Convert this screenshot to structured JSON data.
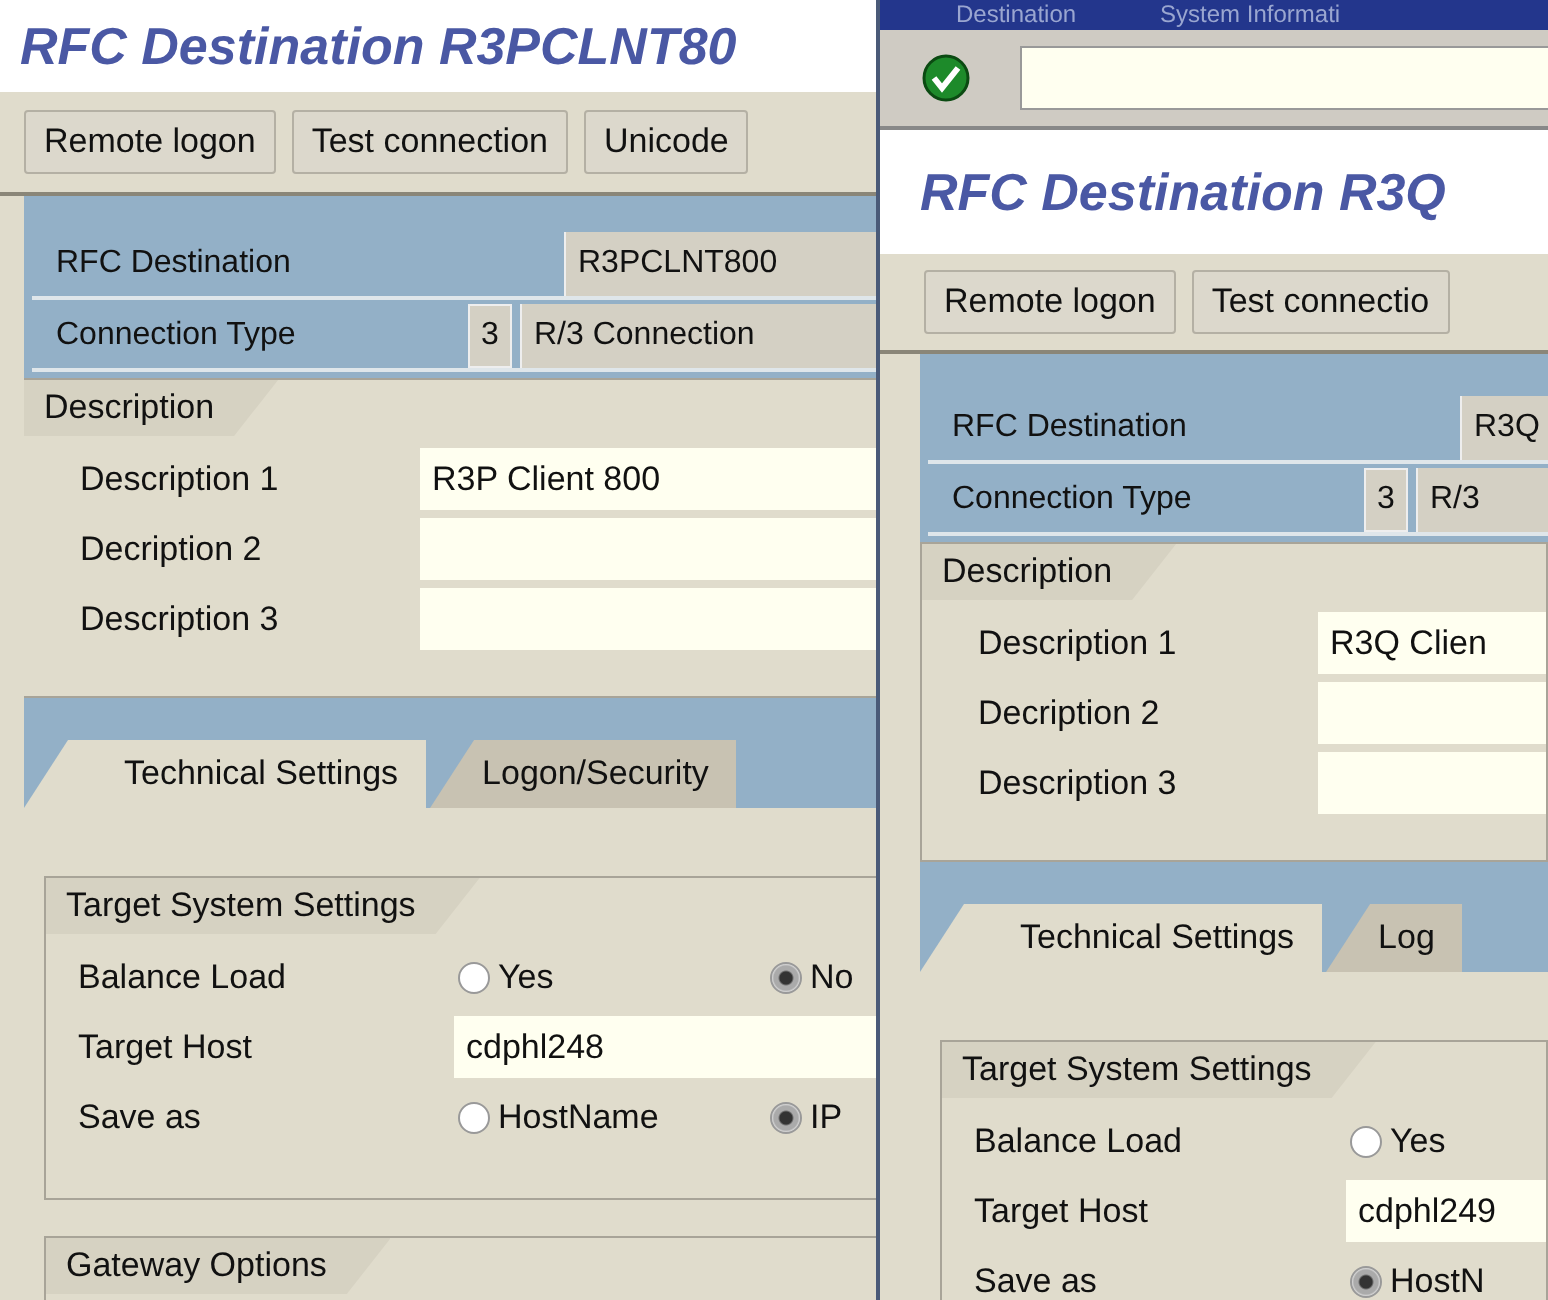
{
  "back_window": {
    "title": "RFC Destination R3PCLNT80",
    "buttons": [
      "Remote logon",
      "Test connection",
      "Unicode"
    ],
    "rfc_destination": {
      "label": "RFC Destination",
      "value": "R3PCLNT800"
    },
    "connection_type": {
      "label": "Connection Type",
      "code": "3",
      "value": "R/3 Connection"
    },
    "description": {
      "title": "Description",
      "fields": [
        {
          "label": "Description 1",
          "value": "R3P Client 800"
        },
        {
          "label": "Decription 2"
        },
        {
          "label": "Description 3"
        }
      ]
    },
    "tabs": [
      {
        "label": "Technical Settings",
        "selected": true
      },
      {
        "label": "Logon/Security",
        "selected": false
      }
    ],
    "target_system": {
      "title": "Target System Settings",
      "rows": [
        {
          "kind": "radio",
          "label": "Balance Load",
          "options": [
            {
              "label": "Yes",
              "selected": false
            },
            {
              "label": "No",
              "selected": true
            }
          ]
        },
        {
          "kind": "text",
          "label": "Target Host",
          "value": "cdphl248"
        },
        {
          "kind": "radio",
          "label": "Save as",
          "options": [
            {
              "label": "HostName",
              "selected": false
            },
            {
              "label": "IP",
              "selected": true
            }
          ]
        }
      ]
    },
    "gateway_options": {
      "title": "Gateway Options"
    }
  },
  "front_window": {
    "menu": [
      "Destination",
      "System Informati"
    ],
    "title": "RFC Destination R3Q",
    "buttons": [
      "Remote logon",
      "Test connectio"
    ],
    "rfc_destination": {
      "label": "RFC Destination",
      "value": "R3Q"
    },
    "connection_type": {
      "label": "Connection Type",
      "code": "3",
      "value": "R/3"
    },
    "description": {
      "title": "Description",
      "fields": [
        {
          "label": "Description 1",
          "value": "R3Q Clien"
        },
        {
          "label": "Decription 2"
        },
        {
          "label": "Description 3"
        }
      ]
    },
    "tabs": [
      {
        "label": "Technical Settings",
        "selected": true
      },
      {
        "label": "Log",
        "selected": false
      }
    ],
    "target_system": {
      "title": "Target System Settings",
      "rows": [
        {
          "kind": "radio",
          "label": "Balance Load",
          "options": [
            {
              "label": "Yes",
              "selected": false
            }
          ]
        },
        {
          "kind": "text",
          "label": "Target Host",
          "value": "cdphl249"
        },
        {
          "kind": "radio",
          "label": "Save as",
          "options": [
            {
              "label": "HostN",
              "selected": true
            }
          ]
        }
      ]
    }
  }
}
